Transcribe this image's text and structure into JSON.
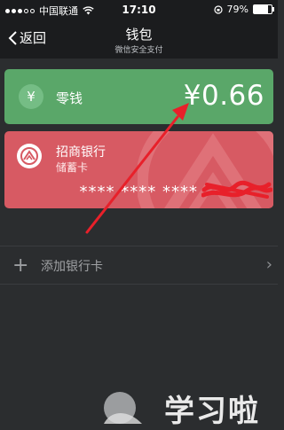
{
  "status_bar": {
    "carrier": "中国联通",
    "time": "17:10",
    "battery_percent": "79%",
    "battery_level": 0.79
  },
  "nav": {
    "back_label": "返回",
    "title": "钱包",
    "subtitle": "微信安全支付"
  },
  "change_card": {
    "icon": "yen-icon",
    "label": "零钱",
    "amount": "¥0.66",
    "color": "#5aa769"
  },
  "bank_card": {
    "name": "招商银行",
    "type": "储蓄卡",
    "number_masked": "**** **** ****",
    "color": "#d75a63"
  },
  "add_card": {
    "label": "添加银行卡"
  },
  "annotation": {
    "arrow_color": "#e8202a"
  },
  "watermark": {
    "text": "学习啦"
  }
}
